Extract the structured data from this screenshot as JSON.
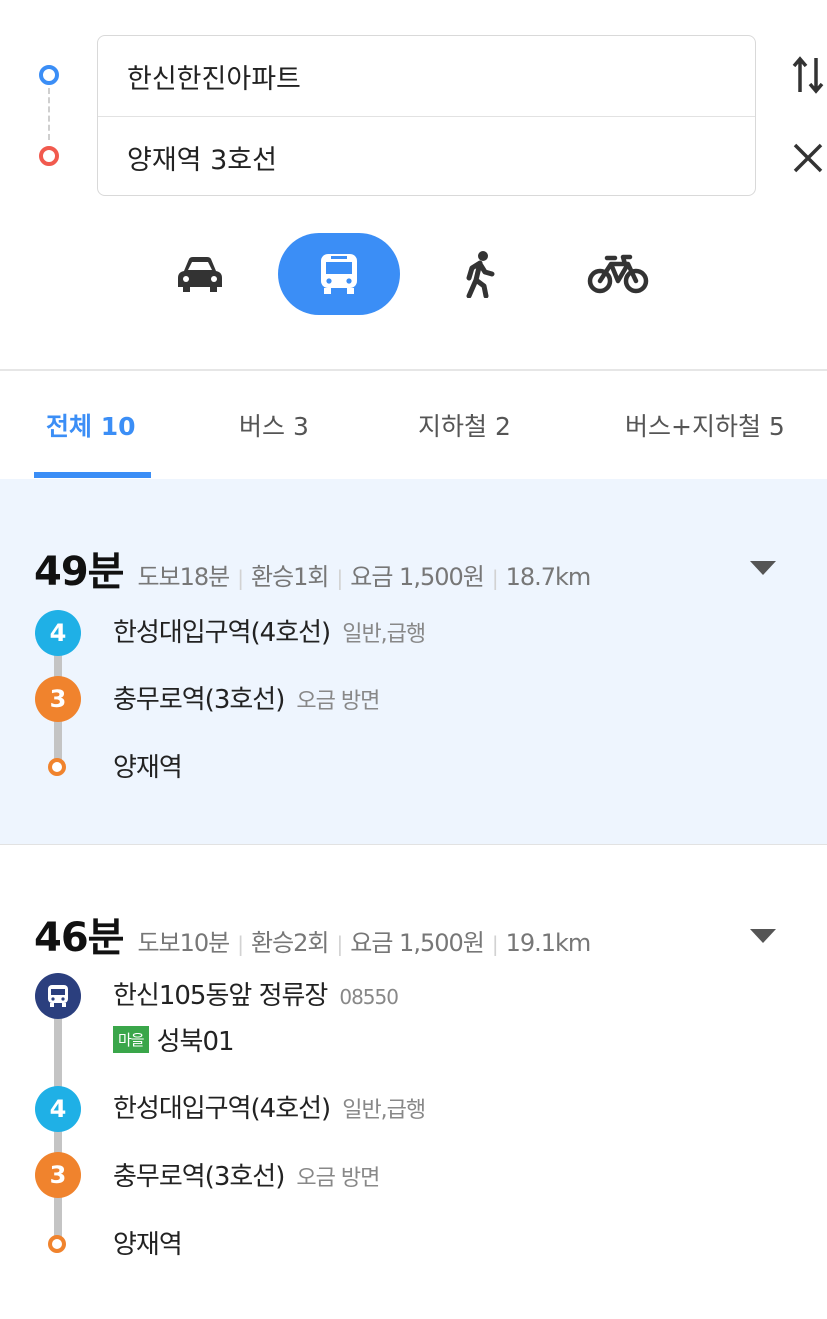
{
  "search": {
    "origin": "한신한진아파트",
    "destination": "양재역 3호선",
    "swap_icon": "swap-vertical-icon",
    "clear_icon": "close-icon"
  },
  "modes": [
    {
      "name": "car",
      "icon": "car-icon",
      "active": false
    },
    {
      "name": "transit",
      "icon": "bus-icon",
      "active": true
    },
    {
      "name": "walk",
      "icon": "walk-icon",
      "active": false
    },
    {
      "name": "bike",
      "icon": "bicycle-icon",
      "active": false
    }
  ],
  "tabs": [
    {
      "label": "전체 10",
      "active": true
    },
    {
      "label": "버스 3",
      "active": false
    },
    {
      "label": "지하철 2",
      "active": false
    },
    {
      "label": "버스+지하철 5",
      "active": false
    }
  ],
  "colors": {
    "accent": "#3b8ef6",
    "line4": "#1fb0e6",
    "line3": "#f0832d",
    "bus": "#2b3f7e",
    "village_bus_tag": "#3aa64a",
    "start_dot": "#3b8ef6",
    "end_dot": "#f15a4e"
  },
  "routes": [
    {
      "duration": "49분",
      "walk": "도보18분",
      "transfer": "환승1회",
      "fare": "요금 1,500원",
      "distance": "18.7km",
      "steps": [
        {
          "badge": "4",
          "name": "한성대입구역(4호선)",
          "sub": "일반,급행"
        },
        {
          "badge": "3",
          "name": "충무로역(3호선)",
          "sub": "오금 방면"
        },
        {
          "name": "양재역"
        }
      ]
    },
    {
      "duration": "46분",
      "walk": "도보10분",
      "transfer": "환승2회",
      "fare": "요금 1,500원",
      "distance": "19.1km",
      "steps": [
        {
          "badge_icon": "bus-icon",
          "name": "한신105동앞 정류장",
          "sub": "08550",
          "tag": "마을",
          "bus_no": "성북01"
        },
        {
          "badge": "4",
          "name": "한성대입구역(4호선)",
          "sub": "일반,급행"
        },
        {
          "badge": "3",
          "name": "충무로역(3호선)",
          "sub": "오금 방면"
        },
        {
          "name": "양재역"
        }
      ]
    }
  ]
}
